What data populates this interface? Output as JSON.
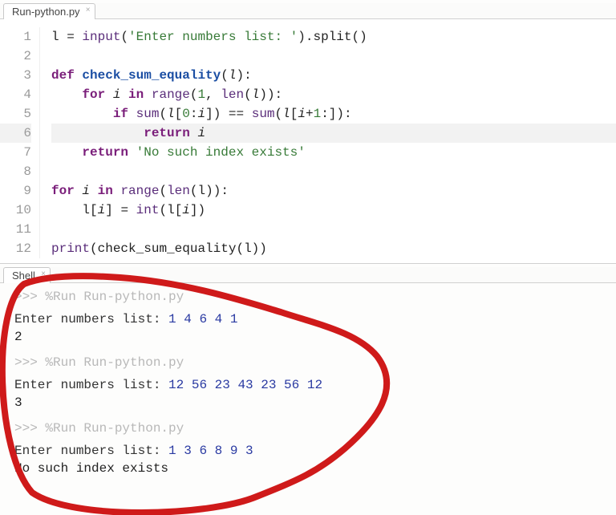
{
  "tabs": {
    "editor": "Run-python.py",
    "shell": "Shell"
  },
  "editor": {
    "gutter": [
      "1",
      "2",
      "3",
      "4",
      "5",
      "6",
      "7",
      "8",
      "9",
      "10",
      "11",
      "12"
    ],
    "highlighted_line": 6,
    "code_plain": [
      "l = input('Enter numbers list: ').split()",
      "",
      "def check_sum_equality(l):",
      "    for i in range(1, len(l)):",
      "        if sum(l[0:i]) == sum(l[i+1:]):",
      "            return i",
      "    return 'No such index exists'",
      "",
      "for i in range(len(l)):",
      "    l[i] = int(l[i])",
      "",
      "print(check_sum_equality(l))"
    ],
    "tok": {
      "l": "l",
      "i": "i",
      "eq": " = ",
      "eqeq": " == ",
      "input": "input",
      "split": "split",
      "def": "def",
      "for": "for",
      "in": "in",
      "if": "if",
      "return": "return",
      "range": "range",
      "len": "len",
      "sum": "sum",
      "int": "int",
      "print": "print",
      "fn_name": "check_sum_equality",
      "str_prompt": "'Enter numbers list: '",
      "str_noidx": "'No such index exists'",
      "one": "1",
      "zero": "0",
      "open": "(",
      "close": ")",
      "obrk": "[",
      "cbrk": "]",
      "colon": ":",
      "comma": ", ",
      "dot": ".",
      "plus": "+",
      "sp4": "    ",
      "sp8": "        ",
      "sp12": "            "
    }
  },
  "shell": {
    "prompt": ">>> ",
    "run_cmd": "%Run Run-python.py",
    "input_label": "Enter numbers list: ",
    "runs": [
      {
        "values": "1 4 6 4 1",
        "output": "2"
      },
      {
        "values": "12 56 23 43 23 56 12",
        "output": "3"
      },
      {
        "values": "1 3 6 8 9 3",
        "output": "No such index exists"
      }
    ]
  },
  "annotation": {
    "stroke": "#cf1a1a",
    "width": 8
  }
}
